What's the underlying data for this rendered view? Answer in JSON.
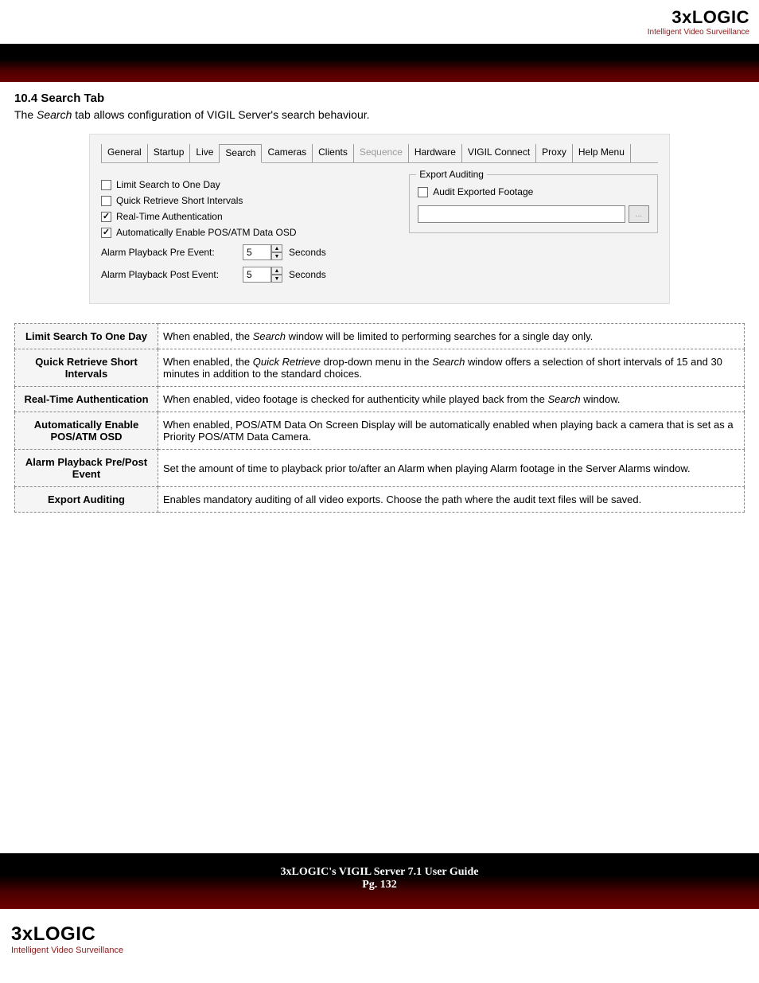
{
  "brand": {
    "name": "3xLOGIC",
    "tagline": "Intelligent Video Surveillance"
  },
  "section": {
    "number_title": "10.4 Search Tab",
    "description_pre": "The ",
    "description_em": "Search",
    "description_post": " tab allows configuration of VIGIL Server's search behaviour."
  },
  "tabs": [
    {
      "label": "General",
      "active": false,
      "disabled": false
    },
    {
      "label": "Startup",
      "active": false,
      "disabled": false
    },
    {
      "label": "Live",
      "active": false,
      "disabled": false
    },
    {
      "label": "Search",
      "active": true,
      "disabled": false
    },
    {
      "label": "Cameras",
      "active": false,
      "disabled": false
    },
    {
      "label": "Clients",
      "active": false,
      "disabled": false
    },
    {
      "label": "Sequence",
      "active": false,
      "disabled": true
    },
    {
      "label": "Hardware",
      "active": false,
      "disabled": false
    },
    {
      "label": "VIGIL Connect",
      "active": false,
      "disabled": false
    },
    {
      "label": "Proxy",
      "active": false,
      "disabled": false
    },
    {
      "label": "Help Menu",
      "active": false,
      "disabled": false
    }
  ],
  "checkboxes": {
    "limit_one_day": {
      "label": "Limit Search to One Day",
      "checked": false
    },
    "quick_retrieve": {
      "label": "Quick Retrieve Short Intervals",
      "checked": false
    },
    "realtime_auth": {
      "label": "Real-Time Authentication",
      "checked": true
    },
    "auto_pos_osd": {
      "label": "Automatically Enable POS/ATM Data OSD",
      "checked": true
    }
  },
  "spinners": {
    "pre_event": {
      "label": "Alarm Playback Pre Event:",
      "value": "5",
      "unit": "Seconds"
    },
    "post_event": {
      "label": "Alarm Playback Post Event:",
      "value": "5",
      "unit": "Seconds"
    }
  },
  "export_auditing": {
    "legend": "Export Auditing",
    "audit_label": "Audit Exported Footage",
    "audit_checked": false,
    "path_value": "",
    "browse_label": "..."
  },
  "definitions": [
    {
      "term": "Limit Search To One Day",
      "desc_parts": [
        "When enabled, the ",
        "Search",
        " window will be limited to performing searches for a single day only."
      ]
    },
    {
      "term": "Quick Retrieve Short Intervals",
      "desc_parts": [
        "When enabled, the ",
        "Quick Retrieve",
        " drop-down menu in the ",
        "Search",
        " window offers a selection of short intervals of 15 and 30 minutes in addition to the standard choices."
      ]
    },
    {
      "term": "Real-Time Authentication",
      "desc_parts": [
        "When enabled, video footage is checked for authenticity while played back from the ",
        "Search",
        " window."
      ]
    },
    {
      "term": "Automatically Enable POS/ATM OSD",
      "desc_parts": [
        "When enabled, POS/ATM Data On Screen Display will be automatically enabled when playing back a camera that is set as a Priority POS/ATM Data Camera."
      ]
    },
    {
      "term": "Alarm Playback Pre/Post Event",
      "desc_parts": [
        "Set the amount of time to playback prior to/after an Alarm when playing Alarm footage in the Server Alarms window."
      ]
    },
    {
      "term": "Export Auditing",
      "desc_parts": [
        "Enables mandatory auditing of all video exports. Choose the path where the audit text files will be saved."
      ]
    }
  ],
  "footer": {
    "title": "3xLOGIC's VIGIL Server 7.1 User Guide",
    "page": "Pg. 132"
  }
}
